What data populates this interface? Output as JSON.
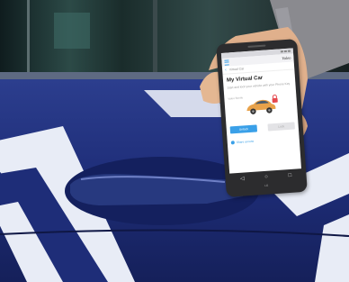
{
  "photo": {
    "subject": "hand holding smartphone next to blue car door handle",
    "colors": {
      "car_blue": "#1f2f7a",
      "stripe": "#e8ecf6",
      "window_glass": "#1c2a2c",
      "skin": "#e0b08c",
      "sleeve": "#8a8a8f",
      "app_accent": "#3aa0e8",
      "car_orange": "#e8a24a"
    }
  },
  "app": {
    "header_brand": "Valeo",
    "nav_text": "Virtual Car",
    "title": "My Virtual Car",
    "description": "Start and lock your vehicle with your Phone Key",
    "car_label": "Valeo Beetle",
    "primary_button": "Unlock",
    "secondary_button": "Lock",
    "bottom_link": "Share access",
    "icons": [
      "back-arrow-icon",
      "menu-icon",
      "lock-icon",
      "car-icon"
    ]
  },
  "device": {
    "nav_icons": [
      "back-icon",
      "home-icon",
      "recents-icon"
    ],
    "chin_logo": "LG"
  }
}
